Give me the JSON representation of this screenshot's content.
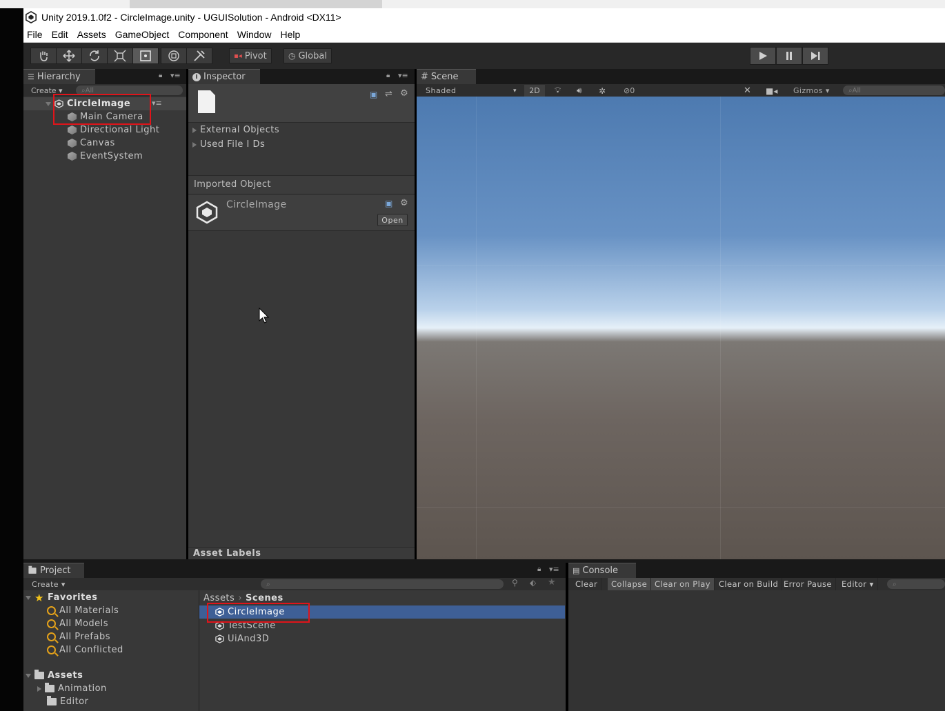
{
  "window": {
    "title": "Unity 2019.1.0f2 - CircleImage.unity - UGUISolution - Android <DX11>"
  },
  "menu": [
    "File",
    "Edit",
    "Assets",
    "GameObject",
    "Component",
    "Window",
    "Help"
  ],
  "toolbar": {
    "pivot_label": "Pivot",
    "global_label": "Global"
  },
  "hierarchy": {
    "tab_label": "Hierarchy",
    "create_label": "Create",
    "search_placeholder": "All",
    "scene_name": "CircleImage",
    "items": [
      "Main Camera",
      "Directional Light",
      "Canvas",
      "EventSystem"
    ]
  },
  "inspector": {
    "tab_label": "Inspector",
    "foldouts": [
      "External Objects",
      "Used File I Ds"
    ],
    "imported_object_label": "Imported Object",
    "asset_name": "CircleImage",
    "open_label": "Open",
    "asset_labels_label": "Asset Labels"
  },
  "scene": {
    "tab_label": "Scene",
    "shading_mode": "Shaded",
    "mode_2d": "2D",
    "hidden_count": "0",
    "gizmos_label": "Gizmos",
    "search_placeholder": "All"
  },
  "project": {
    "tab_label": "Project",
    "create_label": "Create",
    "favorites_label": "Favorites",
    "favorites": [
      "All Materials",
      "All Models",
      "All Prefabs",
      "All Conflicted"
    ],
    "assets_label": "Assets",
    "asset_folders": [
      "Animation",
      "Editor"
    ],
    "breadcrumb_root": "Assets",
    "breadcrumb_current": "Scenes",
    "files": [
      "CircleImage",
      "TestScene",
      "UiAnd3D"
    ],
    "selected_file": "CircleImage"
  },
  "console": {
    "tab_label": "Console",
    "buttons": [
      "Clear",
      "Collapse",
      "Clear on Play",
      "Clear on Build",
      "Error Pause",
      "Editor"
    ]
  },
  "colors": {
    "selection": "#3e5f96",
    "highlight_box": "#e0141a",
    "panel_bg": "#383838"
  }
}
